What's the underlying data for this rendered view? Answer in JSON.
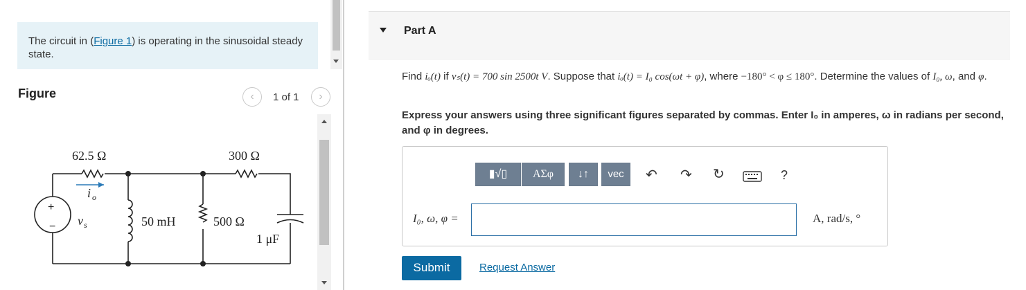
{
  "intro": {
    "text_before": "The circuit in (",
    "link": "Figure 1",
    "text_after": ") is operating in the sinusoidal steady state."
  },
  "figure": {
    "title": "Figure",
    "counter": "1 of 1",
    "prev_icon": "chevron-left-icon",
    "next_icon": "chevron-right-icon",
    "labels": {
      "r1": "62.5 Ω",
      "r2": "300 Ω",
      "io": "i",
      "io_sub": "o",
      "vs": "v",
      "vs_sub": "s",
      "l": "50 mH",
      "r3": "500 Ω",
      "c": "1 μF",
      "plus": "+",
      "minus": "−"
    }
  },
  "part": {
    "title": "Part A",
    "question_1": "Find ",
    "question_2": " if ",
    "question_3": ". Suppose that ",
    "question_4": ", where ",
    "question_5": ". Determine the values of ",
    "question_6": ", and ",
    "q_io": "iₒ(t)",
    "q_vs": "vₛ(t) = 700 sin 2500t V",
    "q_form": "iₒ(t) = I₀ cos(ωt + φ)",
    "q_range": "−180° < φ ≤ 180°",
    "q_vars": "I₀, ω",
    "q_phi": "φ",
    "instructions": "Express your answers using three significant figures separated by commas. Enter I₀ in amperes, ω in radians per second, and φ in degrees."
  },
  "toolbar": {
    "templates_label": "▮√▯",
    "greek_label": "ΑΣφ",
    "arrows_label": "↓↑",
    "vec_label": "vec",
    "help_label": "?",
    "undo_icon": "undo-icon",
    "redo_icon": "redo-icon",
    "reset_icon": "reset-icon",
    "keyboard_icon": "keyboard-icon"
  },
  "answer": {
    "label": "I₀, ω, φ =",
    "value": "",
    "units": "A, rad/s, °"
  },
  "actions": {
    "submit": "Submit",
    "request": "Request Answer"
  },
  "colors": {
    "accent": "#0b6aa2",
    "intro_bg": "#e6f2f7",
    "toolbar_bg": "#6e7f92"
  }
}
